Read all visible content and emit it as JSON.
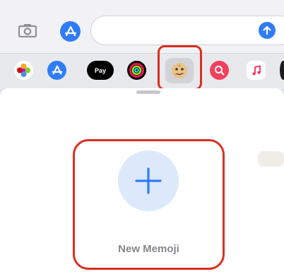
{
  "compose_bar": {
    "camera_icon": "camera-icon",
    "app_store_icon": "app-store-icon",
    "send_icon": "send-arrow-icon",
    "accent_color": "#2f7cf6"
  },
  "app_drawer": {
    "apps": [
      {
        "name": "photos",
        "icon": "photos-icon"
      },
      {
        "name": "app-store",
        "icon": "app-store-icon"
      },
      {
        "name": "apple-pay",
        "icon": "apple-pay-icon",
        "label": "Pay"
      },
      {
        "name": "fitness",
        "icon": "activity-rings-icon"
      },
      {
        "name": "memoji",
        "icon": "memoji-icon",
        "selected": true
      },
      {
        "name": "images",
        "icon": "image-search-icon"
      },
      {
        "name": "music",
        "icon": "music-note-icon"
      }
    ],
    "highlight_color": "#d9301f"
  },
  "memoji_panel": {
    "new_memoji_label": "New Memoji",
    "plus_icon": "plus-icon"
  }
}
